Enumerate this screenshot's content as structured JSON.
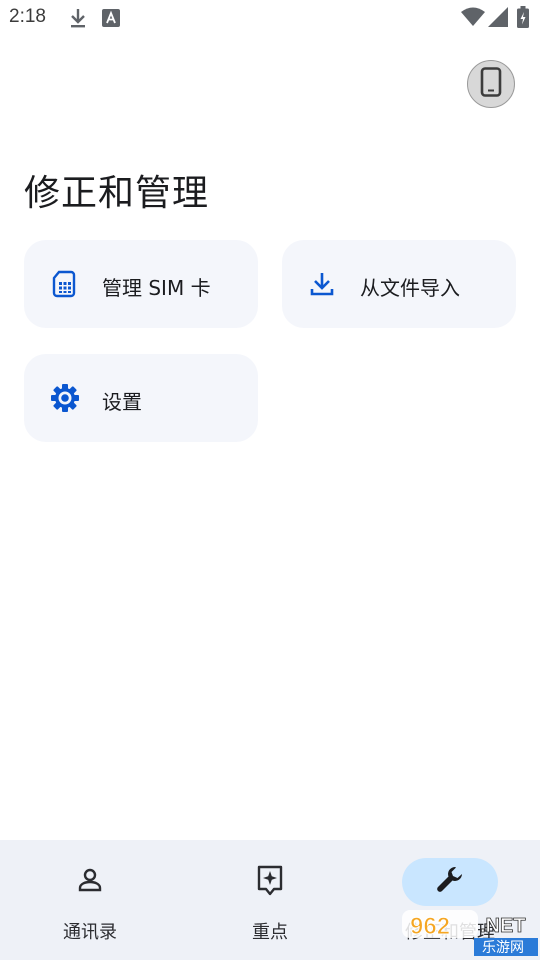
{
  "status_bar": {
    "time": "2:18",
    "icons": [
      "download-icon",
      "text-a-icon",
      "wifi-icon",
      "signal-icon",
      "battery-icon"
    ]
  },
  "header": {
    "device_button_icon": "phone-icon"
  },
  "page": {
    "title": "修正和管理"
  },
  "cards": [
    {
      "label": "管理 SIM 卡",
      "icon": "sim-card-icon"
    },
    {
      "label": "从文件导入",
      "icon": "download-icon"
    },
    {
      "label": "设置",
      "icon": "gear-icon"
    }
  ],
  "bottom_nav": {
    "items": [
      {
        "label": "通讯录",
        "icon": "person-icon",
        "active": false
      },
      {
        "label": "重点",
        "icon": "sparkle-icon",
        "active": false
      },
      {
        "label": "修正和管理",
        "icon": "wrench-icon",
        "active": true
      }
    ]
  },
  "colors": {
    "accent": "#0b57d0",
    "card_bg": "#f4f6fb",
    "nav_bg": "#eef1f7",
    "nav_active_pill": "#c9e6ff"
  },
  "watermark": {
    "text_top": "962.NET",
    "text_bottom": "乐游网"
  }
}
